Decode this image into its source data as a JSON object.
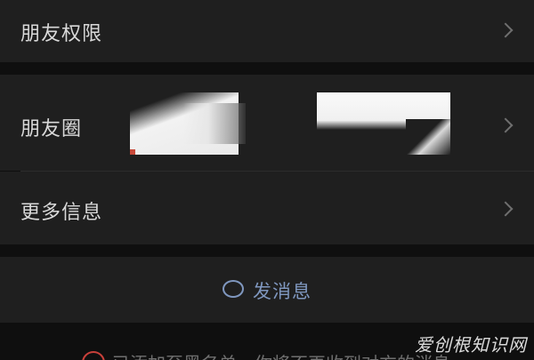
{
  "rows": {
    "permissions": {
      "label": "朋友权限"
    },
    "moments": {
      "label": "朋友圈"
    },
    "more_info": {
      "label": "更多信息"
    }
  },
  "actions": {
    "send_message": {
      "label": "发消息",
      "icon": "chat-bubble-icon"
    }
  },
  "notice": {
    "text": "已添加至黑名单，你将不再收到对方的消息",
    "icon": "warning-icon"
  },
  "watermark": {
    "text": "爱创根知识网"
  },
  "colors": {
    "background": "#0f0f0f",
    "row_background": "#1f1f1f",
    "text": "#d9d9d9",
    "accent_link": "#7f97bf",
    "warning": "#c9403a"
  }
}
